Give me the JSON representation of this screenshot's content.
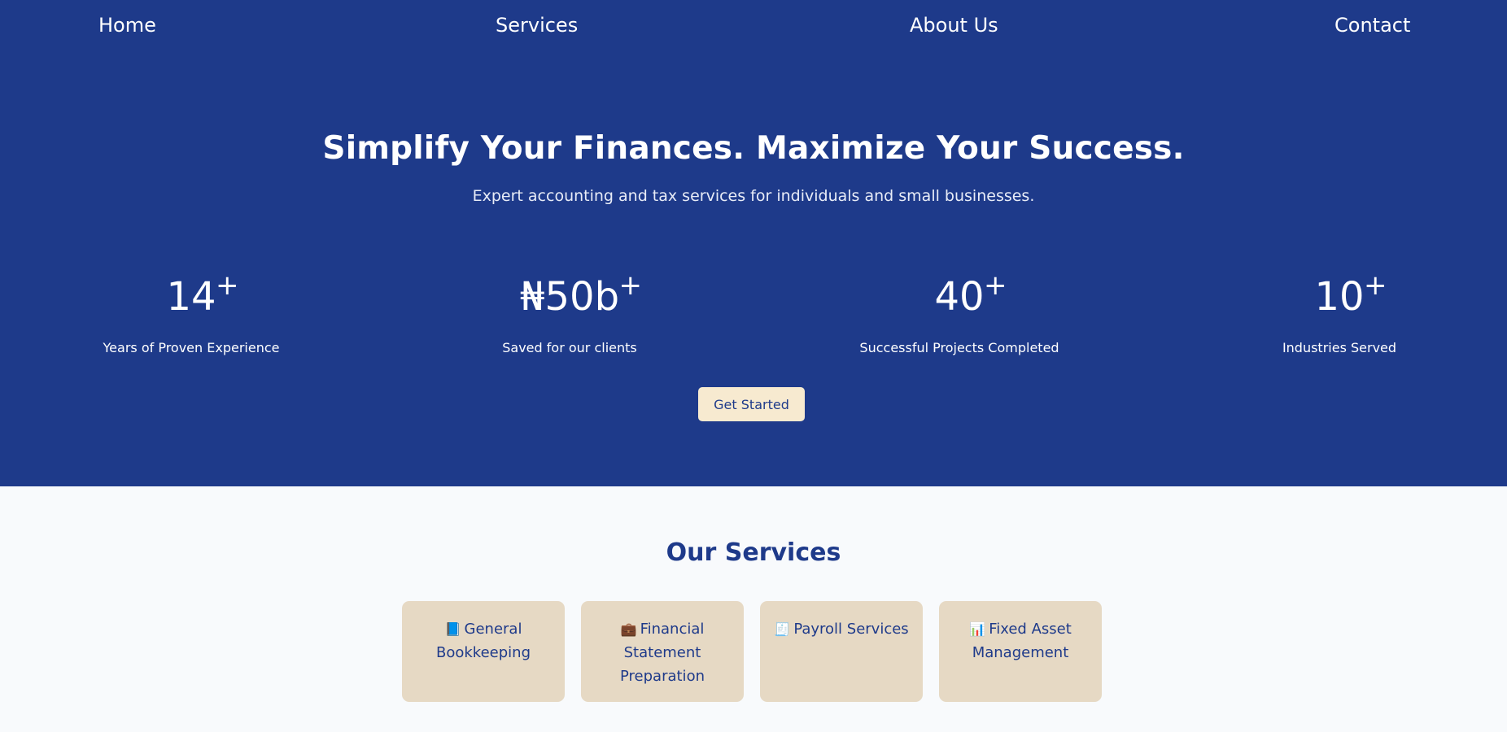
{
  "nav": {
    "home": "Home",
    "services": "Services",
    "about": "About Us",
    "contact": "Contact"
  },
  "hero": {
    "headline": "Simplify Your Finances. Maximize Your Success.",
    "subheadline": "Expert accounting and tax services for individuals and small businesses.",
    "cta_label": "Get Started"
  },
  "stats": [
    {
      "value": "14",
      "suffix": "+",
      "label": "Years of Proven Experience"
    },
    {
      "value": "₦50b",
      "suffix": "+",
      "label": "Saved for our clients"
    },
    {
      "value": "40",
      "suffix": "+",
      "label": "Successful Projects Completed"
    },
    {
      "value": "10",
      "suffix": "+",
      "label": "Industries Served"
    }
  ],
  "services": {
    "title": "Our Services",
    "items": [
      {
        "icon": "📘",
        "icon_name": "blue-book-icon",
        "label": "General Bookkeeping"
      },
      {
        "icon": "💼",
        "icon_name": "briefcase-icon",
        "label": "Financial Statement Preparation"
      },
      {
        "icon": "🧾",
        "icon_name": "receipt-icon",
        "label": "Payroll Services"
      },
      {
        "icon": "📊",
        "icon_name": "bar-chart-icon",
        "label": "Fixed Asset Management"
      }
    ]
  },
  "colors": {
    "hero_background": "#1e3a8a",
    "page_background": "#f8fafc",
    "card_background": "#e6d9c4",
    "cta_background": "#f7ead0",
    "text_accent": "#1e3a8a"
  }
}
